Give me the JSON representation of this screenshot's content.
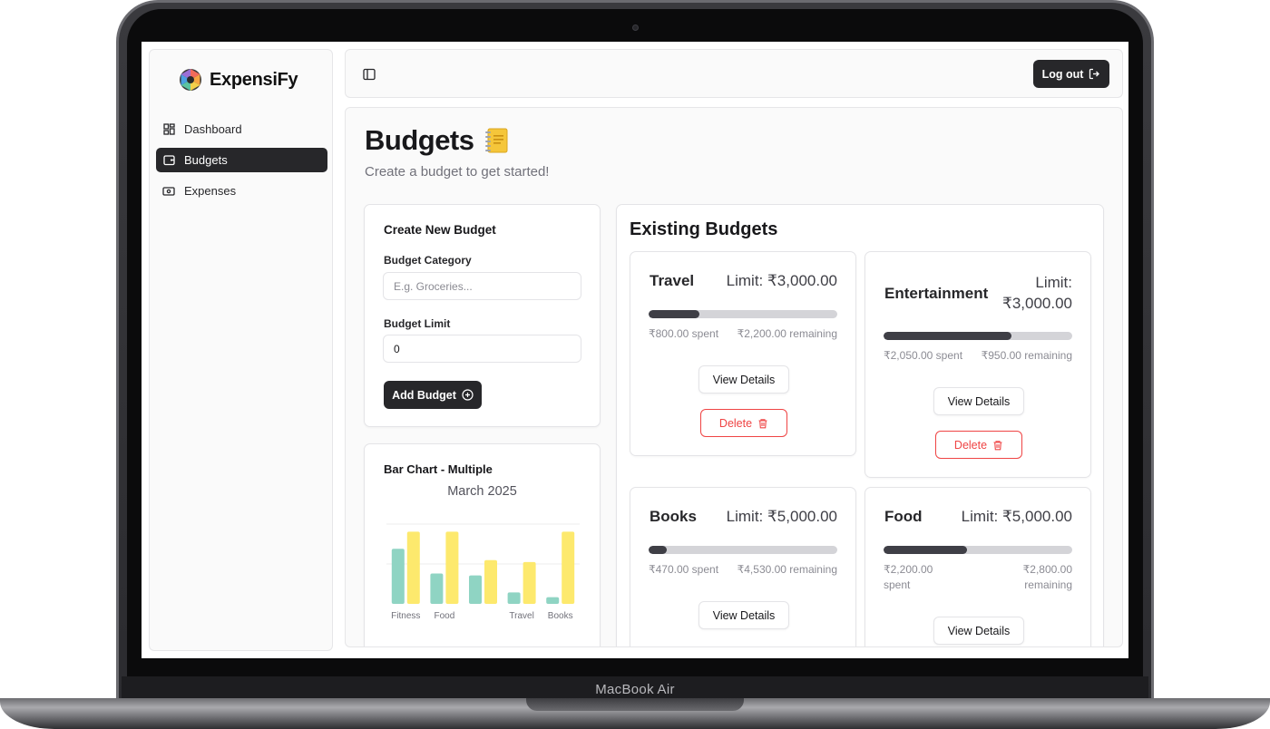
{
  "device": {
    "label": "MacBook Air"
  },
  "brand": {
    "name": "ExpensiFy"
  },
  "sidebar": {
    "items": [
      {
        "label": "Dashboard",
        "icon": "dashboard-grid-icon",
        "active": false
      },
      {
        "label": "Budgets",
        "icon": "wallet-icon",
        "active": true
      },
      {
        "label": "Expenses",
        "icon": "banknote-icon",
        "active": false
      }
    ]
  },
  "topbar": {
    "logout_label": "Log out"
  },
  "page": {
    "title": "Budgets",
    "subtitle": "Create a budget to get started!"
  },
  "create_form": {
    "title": "Create New Budget",
    "category_label": "Budget Category",
    "category_placeholder": "E.g. Groceries...",
    "limit_label": "Budget Limit",
    "limit_value": "0",
    "add_label": "Add Budget"
  },
  "chart": {
    "title": "Bar Chart - Multiple",
    "subtitle": "March 2025"
  },
  "chart_data": {
    "type": "bar",
    "title": "Bar Chart - Multiple",
    "subtitle": "March 2025",
    "categories": [
      "Fitness",
      "Food",
      "",
      "Travel",
      "Books"
    ],
    "series": [
      {
        "values": [
          2.9,
          1.6,
          1.5,
          0.6,
          0.35
        ],
        "color": "#8fd4c3"
      },
      {
        "values": [
          3.8,
          3.8,
          2.3,
          2.2,
          3.8
        ],
        "color": "#fde96d"
      }
    ],
    "ylim": [
      0,
      4.2
    ],
    "grid": true,
    "legend": "none"
  },
  "existing": {
    "title": "Existing Budgets",
    "view_label": "View Details",
    "delete_label": "Delete",
    "budgets": [
      {
        "name": "Travel",
        "limit": "Limit: ₹3,000.00",
        "spent": "₹800.00 spent",
        "remaining": "₹2,200.00 remaining",
        "progress": 0.27
      },
      {
        "name": "Entertainment",
        "limit_line1": "Limit:",
        "limit_line2": "₹3,000.00",
        "spent": "₹2,050.00 spent",
        "remaining": "₹950.00 remaining",
        "progress": 0.68
      },
      {
        "name": "Books",
        "limit": "Limit: ₹5,000.00",
        "spent": "₹470.00 spent",
        "remaining": "₹4,530.00 remaining",
        "progress": 0.094
      },
      {
        "name": "Food",
        "limit": "Limit: ₹5,000.00",
        "spent_line1": "₹2,200.00",
        "spent_line2": "spent",
        "remaining_line1": "₹2,800.00",
        "remaining_line2": "remaining",
        "progress": 0.44
      }
    ]
  },
  "colors": {
    "primary_dark": "#27272a",
    "danger": "#ef4444",
    "bar_teal": "#8fd4c3",
    "bar_yellow": "#fde96d"
  }
}
